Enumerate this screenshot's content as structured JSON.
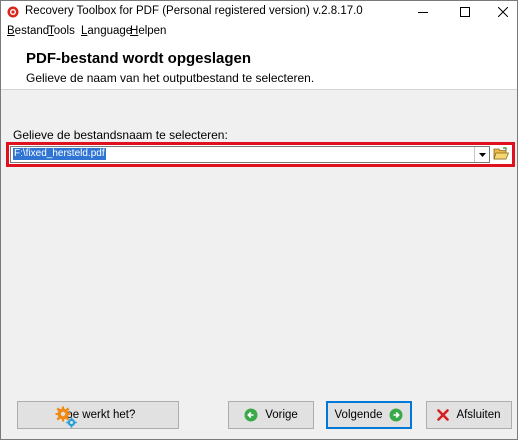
{
  "window": {
    "title": "Recovery Toolbox for PDF (Personal registered version) v.2.8.17.0"
  },
  "menu": {
    "items": [
      {
        "label": "Bestand",
        "mnemonic": "B",
        "rest": "estand"
      },
      {
        "label": "Tools",
        "mnemonic": "T",
        "rest": "ools"
      },
      {
        "label": "Language",
        "mnemonic": "L",
        "rest": "anguage"
      },
      {
        "label": "Helpen",
        "mnemonic": "H",
        "rest": "elpen"
      }
    ]
  },
  "header": {
    "title": "PDF-bestand wordt opgeslagen",
    "subtitle": "Gelieve de naam van het outputbestand te selecteren."
  },
  "form": {
    "label": "Gelieve de bestandsnaam te selecteren:",
    "file_value": "F:\\fixed_hersteld.pdf"
  },
  "buttons": {
    "help": "Hoe werkt het?",
    "prev": "Vorige",
    "next": "Volgende",
    "exit": "Afsluiten"
  },
  "colors": {
    "highlight": "#e0101e",
    "selection": "#3075d4",
    "focus": "#0078d7"
  }
}
